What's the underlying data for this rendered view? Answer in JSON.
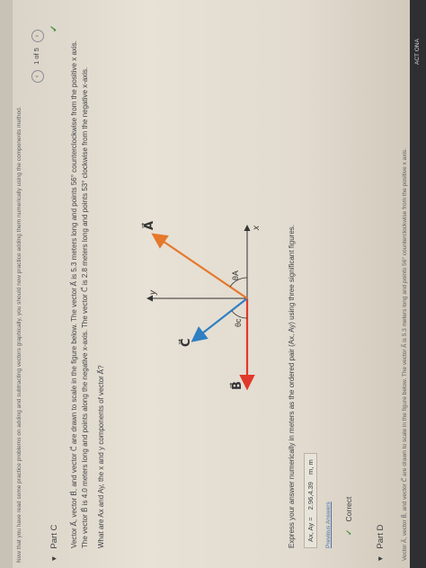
{
  "top_notice": "Now that you have read some practice problems on adding and subtracting vectors graphically, you should now practice adding them numerically using the components method.",
  "pager": {
    "prev": "‹",
    "label": "1 of 5",
    "next": "›"
  },
  "part_c": {
    "heading": "Part C",
    "problem_line1": "Vector A⃗, vector B⃗, and vector C⃗ are drawn to scale in the figure below. The vector A⃗ is 5.3 meters long and points 56° counterclockwise from the positive x axis.",
    "problem_line2": "The vector B⃗ is 4.0 meters long and points along the negative x-axis. The vector C⃗ is 2.8 meters long and points 53° clockwise from the negative x-axis.",
    "question": "What are Ax and Ay, the x and y components of vector A⃗?",
    "figure": {
      "label_y": "y",
      "label_x": "x",
      "label_A": "A⃗",
      "label_B": "B⃗",
      "label_C": "C⃗",
      "label_theta_c": "θc",
      "label_theta_a": "θA",
      "colors": {
        "A": "#e5782a",
        "B": "#e0392b",
        "C": "#2f7fc1",
        "axis": "#333333"
      }
    },
    "instruction": "Express your answer numerically in meters as the ordered pair (Ax, Ay) using three significant figures.",
    "answer": {
      "label": "Ax, Ay =",
      "value": "2.96,4.39",
      "unit": "m, m"
    },
    "previous_answers": "Previous Answers",
    "status": "Correct",
    "status_icon": "check-icon"
  },
  "part_d": {
    "heading": "Part D",
    "text": "Vector A⃗, vector B⃗, and vector C⃗ are drawn to scale in the figure below. The vector A⃗ is 5.3 meters long and points 56° counterclockwise from the positive x axis."
  },
  "bottom_badge": "ACT ONA"
}
